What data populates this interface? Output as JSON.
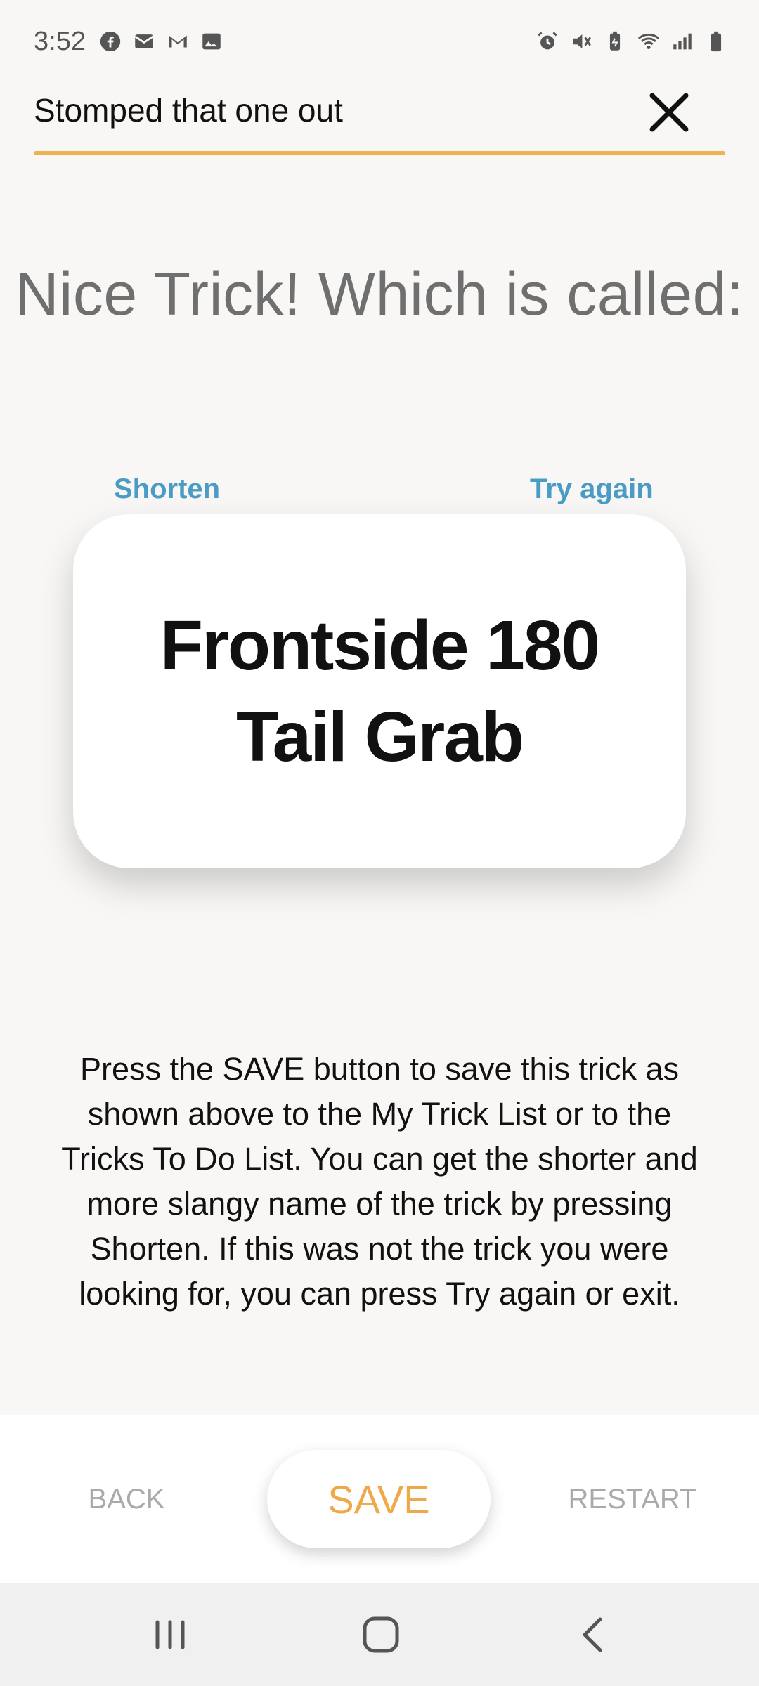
{
  "status": {
    "time": "3:52",
    "left_icons": [
      "facebook-icon",
      "email-icon",
      "gmail-icon",
      "image-icon"
    ],
    "right_icons": [
      "alarm-icon",
      "mute-icon",
      "battery-saver-icon",
      "wifi-icon",
      "signal-icon",
      "battery-icon"
    ]
  },
  "header": {
    "title": "Stomped that one out",
    "close_icon": "close-icon"
  },
  "headline": "Nice Trick! Which is called:",
  "links": {
    "shorten": "Shorten",
    "try_again": "Try again"
  },
  "trick_name": "Frontside 180 Tail Grab",
  "instructions": "Press the SAVE button to save this trick as shown above to the My Trick List or to the Tricks To Do List. You can get the shorter and more slangy name of the trick by pressing Shorten. If this was not the trick you were looking for, you can press Try again or exit.",
  "bottom": {
    "back": "BACK",
    "save": "SAVE",
    "restart": "RESTART"
  },
  "colors": {
    "accent": "#f0b24e",
    "link": "#4a9cc4",
    "save_text": "#f0a94a"
  }
}
